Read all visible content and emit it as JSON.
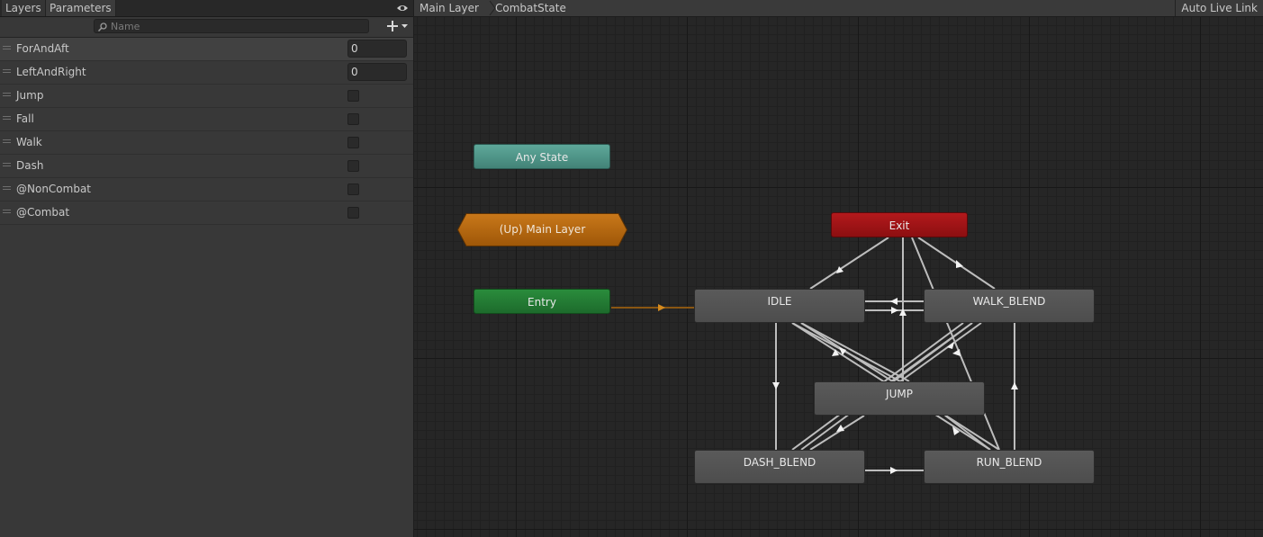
{
  "left_panel": {
    "tabs": {
      "layers": "Layers",
      "parameters": "Parameters"
    },
    "search": {
      "placeholder": "Name",
      "value": ""
    },
    "parameters": [
      {
        "name": "ForAndAft",
        "type": "float",
        "value": "0"
      },
      {
        "name": "LeftAndRight",
        "type": "float",
        "value": "0"
      },
      {
        "name": "Jump",
        "type": "bool",
        "checked": false
      },
      {
        "name": "Fall",
        "type": "bool",
        "checked": false
      },
      {
        "name": "Walk",
        "type": "bool",
        "checked": false
      },
      {
        "name": "Dash",
        "type": "bool",
        "checked": false
      },
      {
        "name": "@NonCombat",
        "type": "bool",
        "checked": false
      },
      {
        "name": "@Combat",
        "type": "bool",
        "checked": false
      }
    ]
  },
  "graph": {
    "breadcrumb": [
      "Main Layer",
      "CombatState"
    ],
    "live_link_label": "Auto Live Link",
    "nodes": {
      "any_state": "Any State",
      "up_layer": "(Up) Main Layer",
      "entry": "Entry",
      "exit": "Exit",
      "idle": "IDLE",
      "walk_blend": "WALK_BLEND",
      "jump": "JUMP",
      "dash_blend": "DASH_BLEND",
      "run_blend": "RUN_BLEND"
    },
    "colors": {
      "any_state": "#4f978a",
      "entry": "#237a33",
      "exit": "#9f1416",
      "up_layer": "#b8660a",
      "state": "#525252",
      "transition": "#c8c8c8",
      "entry_transition": "#9a5a10"
    }
  }
}
